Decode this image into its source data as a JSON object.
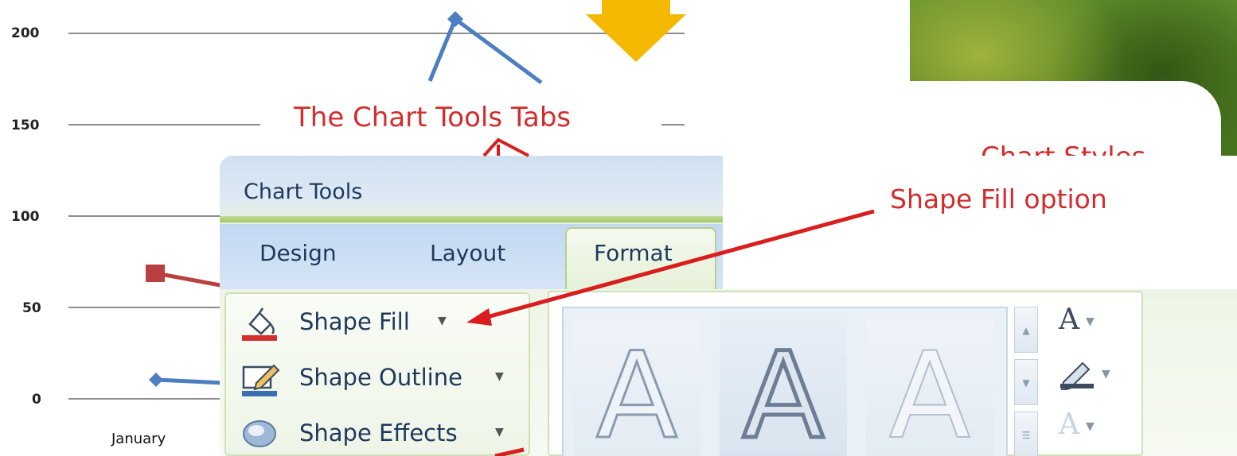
{
  "chart": {
    "y_ticks": [
      "200",
      "150",
      "100",
      "50",
      "0"
    ],
    "categories": [
      "January"
    ]
  },
  "callouts": {
    "chart_tools_tabs": "The Chart Tools Tabs",
    "chart_styles": "Chart Styles",
    "shape_fill_option": "Shape Fill option"
  },
  "ribbon": {
    "context_title": "Chart Tools",
    "tabs": [
      {
        "label": "Design"
      },
      {
        "label": "Layout"
      },
      {
        "label": "Format"
      }
    ],
    "active_tab": "Format",
    "commands": [
      {
        "label": "Shape Fill",
        "icon": "paint-bucket-icon"
      },
      {
        "label": "Shape Outline",
        "icon": "pencil-outline-icon"
      },
      {
        "label": "Shape Effects",
        "icon": "shape-effects-icon"
      }
    ],
    "wordart_gallery": {
      "items": [
        "A",
        "A",
        "A"
      ]
    },
    "side_icons": [
      {
        "glyph": "A",
        "name": "text-fill-icon"
      },
      {
        "glyph": "",
        "name": "text-outline-icon"
      },
      {
        "glyph": "A",
        "name": "text-effects-icon"
      }
    ]
  },
  "colors": {
    "callout_red": "#d22c2c",
    "series_blue": "#4d7fc0",
    "series_red": "#b84040",
    "arrow_yellow": "#f5b800"
  }
}
